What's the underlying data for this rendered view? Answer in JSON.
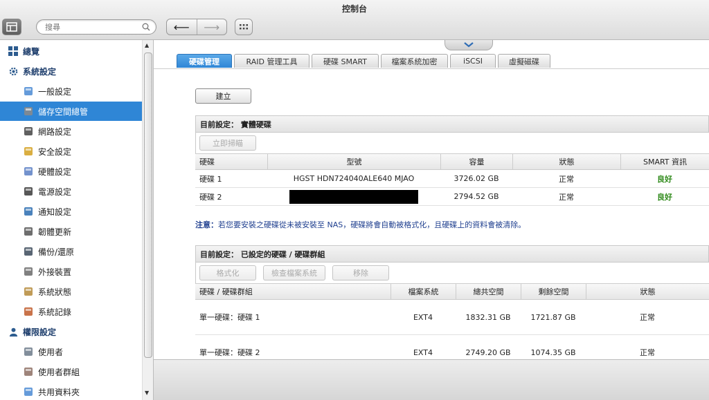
{
  "window": {
    "title": "控制台"
  },
  "search": {
    "placeholder": "搜尋"
  },
  "sidebar": {
    "items": [
      {
        "label": "總覽",
        "icon": "overview-icon",
        "section": true
      },
      {
        "label": "系統設定",
        "icon": "gear-icon",
        "section": true
      },
      {
        "label": "一般設定",
        "icon": "general-settings-icon"
      },
      {
        "label": "儲存空間總管",
        "icon": "storage-icon",
        "active": true
      },
      {
        "label": "網路設定",
        "icon": "network-icon"
      },
      {
        "label": "安全設定",
        "icon": "lock-icon"
      },
      {
        "label": "硬體設定",
        "icon": "hardware-icon"
      },
      {
        "label": "電源設定",
        "icon": "power-icon"
      },
      {
        "label": "通知設定",
        "icon": "notification-icon"
      },
      {
        "label": "韌體更新",
        "icon": "firmware-icon"
      },
      {
        "label": "備份/還原",
        "icon": "backup-icon"
      },
      {
        "label": "外接裝置",
        "icon": "external-device-icon"
      },
      {
        "label": "系統狀態",
        "icon": "system-status-icon"
      },
      {
        "label": "系統記錄",
        "icon": "system-log-icon"
      },
      {
        "label": "權限設定",
        "icon": "user-icon",
        "section": true
      },
      {
        "label": "使用者",
        "icon": "user-icon"
      },
      {
        "label": "使用者群組",
        "icon": "user-group-icon"
      },
      {
        "label": "共用資料夾",
        "icon": "shared-folder-icon"
      }
    ]
  },
  "tabs": [
    "硬碟管理",
    "RAID 管理工具",
    "硬碟 SMART",
    "檔案系統加密",
    "iSCSI",
    "虛擬磁碟"
  ],
  "create_button": "建立",
  "physical": {
    "title": "目前設定： 實體硬碟",
    "scan_button": "立即掃瞄",
    "columns": [
      "硬碟",
      "型號",
      "容量",
      "狀態",
      "SMART 資訊"
    ],
    "rows": [
      {
        "disk": "硬碟 1",
        "model": "HGST HDN724040ALE640 MJAO",
        "capacity": "3726.02 GB",
        "status": "正常",
        "smart": "良好"
      },
      {
        "disk": "硬碟 2",
        "model": "",
        "capacity": "2794.52 GB",
        "status": "正常",
        "smart": "良好"
      }
    ]
  },
  "note": {
    "label": "注意：",
    "text": "若您要安裝之硬碟從未被安裝至 NAS，硬碟將會自動被格式化，且硬碟上的資料會被清除。"
  },
  "volumes": {
    "title": "目前設定： 已設定的硬碟 / 硬碟群組",
    "buttons": [
      "格式化",
      "檢查檔案系統",
      "移除"
    ],
    "columns": [
      "硬碟 / 硬碟群組",
      "檔案系統",
      "總共空間",
      "剩餘空間",
      "狀態"
    ],
    "rows": [
      {
        "name": "單一硬碟：硬碟 1",
        "fs": "EXT4",
        "total": "1832.31 GB",
        "free": "1721.87 GB",
        "status": "正常"
      },
      {
        "name": "單一硬碟：硬碟 2",
        "fs": "EXT4",
        "total": "2749.20 GB",
        "free": "1074.35 GB",
        "status": "正常"
      }
    ]
  }
}
